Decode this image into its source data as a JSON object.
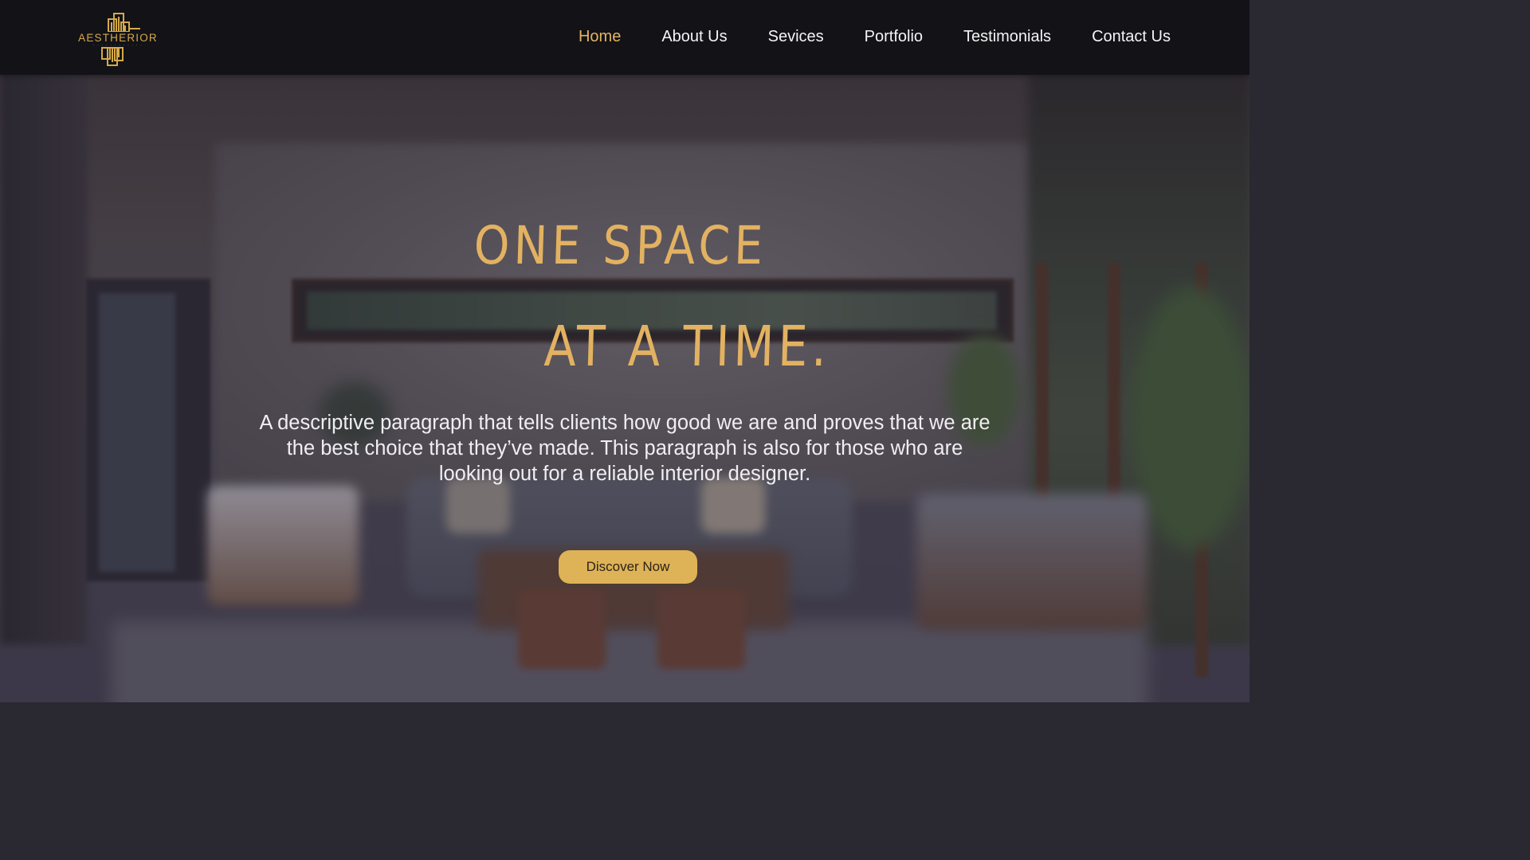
{
  "brand": {
    "logo_text": "AESTHERIOR",
    "accent_color": "#E2B262",
    "header_bg": "#121217"
  },
  "nav": {
    "items": [
      {
        "label": "Home",
        "active": true
      },
      {
        "label": "About Us",
        "active": false
      },
      {
        "label": "Sevices",
        "active": false
      },
      {
        "label": "Portfolio",
        "active": false
      },
      {
        "label": "Testimonials",
        "active": false
      },
      {
        "label": "Contact Us",
        "active": false
      }
    ]
  },
  "hero": {
    "headline_line1": "ONE SPACE",
    "headline_line2": "AT A TIME.",
    "description": "A descriptive paragraph that tells clients how good we are and proves that we are the best choice that they’ve made. This paragraph is also for those who are looking out for a reliable interior designer.",
    "cta_label": "Discover Now",
    "background": "blurred living room interior photo"
  }
}
